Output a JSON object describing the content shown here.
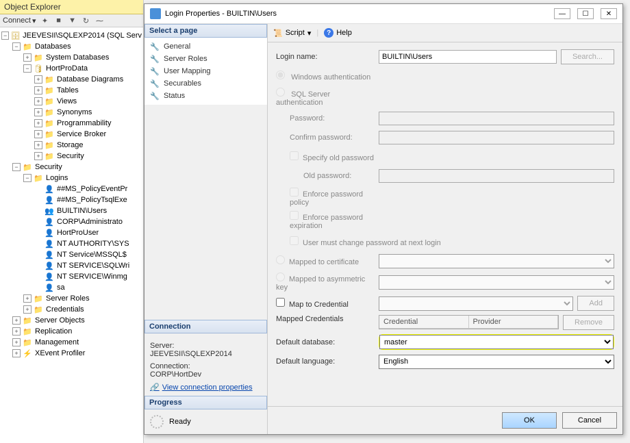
{
  "explorer": {
    "title": "Object Explorer",
    "connect_label": "Connect",
    "server": "JEEVESII\\SQLEXP2014 (SQL Serv",
    "nodes": {
      "databases": "Databases",
      "sys_db": "System Databases",
      "hortpro": "HortProData",
      "diagrams": "Database Diagrams",
      "tables": "Tables",
      "views": "Views",
      "synonyms": "Synonyms",
      "programmability": "Programmability",
      "servicebroker": "Service Broker",
      "storage": "Storage",
      "security_db": "Security",
      "security": "Security",
      "logins": "Logins",
      "login1": "##MS_PolicyEventPr",
      "login2": "##MS_PolicyTsqlExe",
      "login3": "BUILTIN\\Users",
      "login4": "CORP\\Administrato",
      "login5": "HortProUser",
      "login6": "NT AUTHORITY\\SYS",
      "login7": "NT Service\\MSSQL$",
      "login8": "NT SERVICE\\SQLWri",
      "login9": "NT SERVICE\\Winmg",
      "login10": "sa",
      "serverroles": "Server Roles",
      "credentials": "Credentials",
      "serverobjects": "Server Objects",
      "replication": "Replication",
      "management": "Management",
      "xevent": "XEvent Profiler"
    }
  },
  "dialog": {
    "title": "Login Properties - BUILTIN\\Users",
    "select_page": "Select a page",
    "pages": {
      "general": "General",
      "serverroles": "Server Roles",
      "usermapping": "User Mapping",
      "securables": "Securables",
      "status": "Status"
    },
    "connection_hdr": "Connection",
    "server_lbl": "Server:",
    "server_val": "JEEVESII\\SQLEXP2014",
    "conn_lbl": "Connection:",
    "conn_val": "CORP\\HortDev",
    "view_conn": "View connection properties",
    "progress_hdr": "Progress",
    "ready": "Ready",
    "toolbar": {
      "script": "Script",
      "help": "Help"
    },
    "form": {
      "login_name_lbl": "Login name:",
      "login_name_val": "BUILTIN\\Users",
      "search_btn": "Search...",
      "win_auth": "Windows authentication",
      "sql_auth": "SQL Server authentication",
      "password_lbl": "Password:",
      "confirm_lbl": "Confirm password:",
      "specify_old": "Specify old password",
      "old_pwd_lbl": "Old password:",
      "enforce_policy": "Enforce password policy",
      "enforce_exp": "Enforce password expiration",
      "must_change": "User must change password at next login",
      "mapped_cert": "Mapped to certificate",
      "mapped_asym": "Mapped to asymmetric key",
      "map_cred": "Map to Credential",
      "add_btn": "Add",
      "mapped_creds_lbl": "Mapped Credentials",
      "cred_col": "Credential",
      "prov_col": "Provider",
      "remove_btn": "Remove",
      "def_db_lbl": "Default database:",
      "def_db_val": "master",
      "def_lang_lbl": "Default language:",
      "def_lang_val": "English"
    },
    "footer": {
      "ok": "OK",
      "cancel": "Cancel"
    }
  }
}
